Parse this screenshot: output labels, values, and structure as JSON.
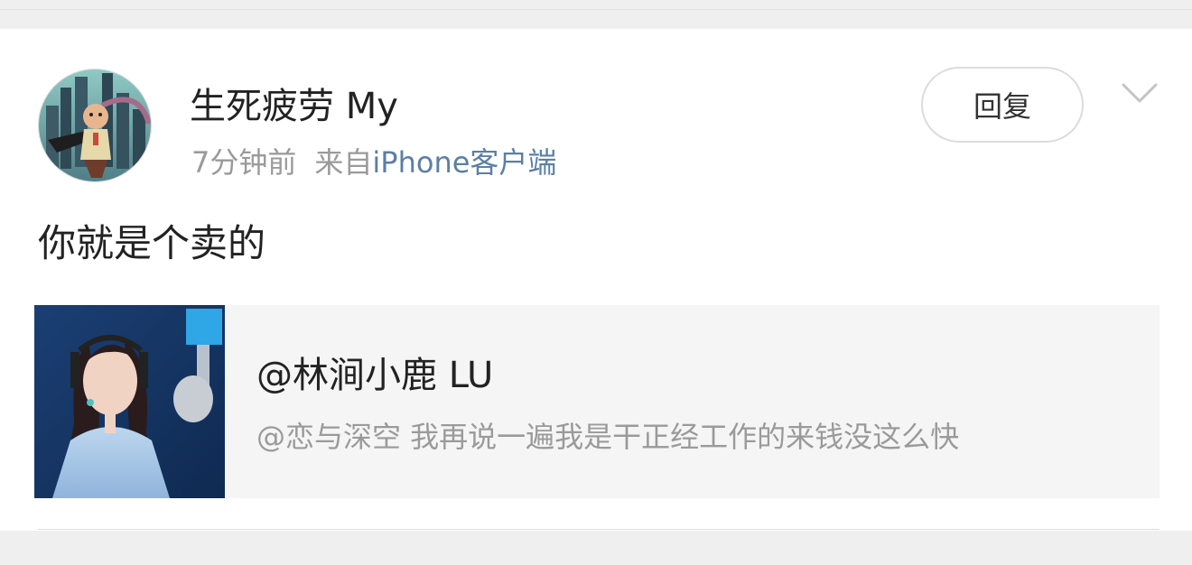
{
  "comment": {
    "username": "生死疲劳 My",
    "time": "7分钟前",
    "source_prefix": "来自",
    "source": "iPhone客户端",
    "text": "你就是个卖的",
    "reply_label": "回复"
  },
  "shared_post": {
    "title": "@林涧小鹿 LU",
    "description": "@恋与深空 我再说一遍我是干正经工作的来钱没这么快"
  },
  "colors": {
    "source_link": "#5b7fa7",
    "card_bg": "#f5f5f5",
    "page_bg": "#efefef"
  },
  "icons": {
    "more": "chevron-down-icon"
  }
}
